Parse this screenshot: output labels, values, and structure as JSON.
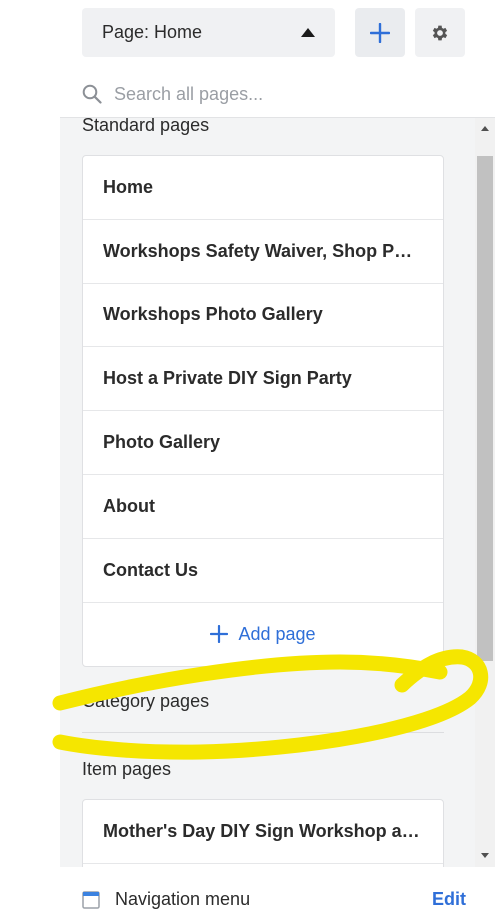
{
  "header": {
    "page_select_label": "Page: Home",
    "search_placeholder": "Search all pages..."
  },
  "standard": {
    "heading": "Standard pages",
    "pages": [
      "Home",
      "Workshops Safety Waiver, Shop Poli...",
      "Workshops Photo Gallery",
      "Host a Private DIY Sign Party",
      "Photo Gallery",
      "About",
      "Contact Us"
    ],
    "add_label": "Add page"
  },
  "category": {
    "heading": "Category pages"
  },
  "items": {
    "heading": "Item pages",
    "pages": [
      "Mother's Day DIY Sign Workshop at ..."
    ]
  },
  "footer": {
    "nav_label": "Navigation menu",
    "edit_label": "Edit"
  },
  "colors": {
    "accent": "#2f6fd8",
    "highlight": "#f5e600"
  },
  "icons": {
    "add": "plus-icon",
    "settings": "gear-icon",
    "search": "search-icon",
    "nav": "browser-window-icon"
  }
}
